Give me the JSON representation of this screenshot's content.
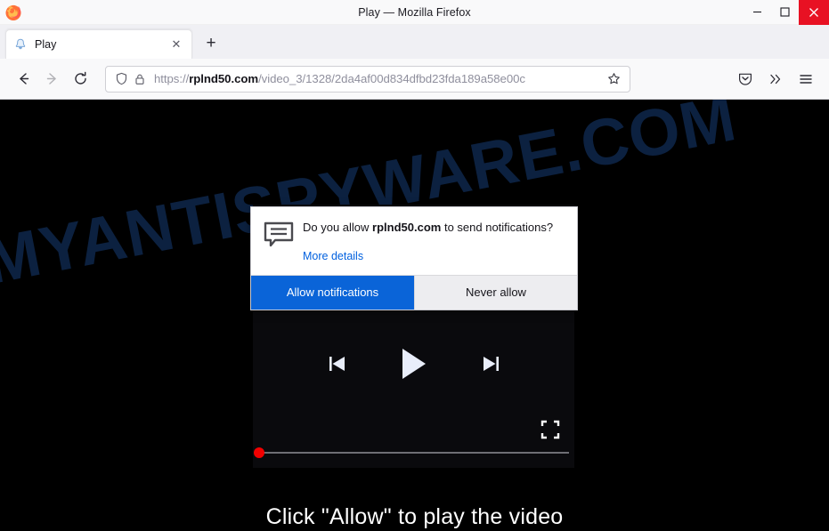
{
  "window": {
    "title": "Play — Mozilla Firefox",
    "controls": {
      "minimize": "—",
      "maximize": "☐",
      "close": "✕"
    }
  },
  "tabs": {
    "items": [
      {
        "label": "Play",
        "favicon": "bell-icon",
        "close_label": "✕"
      }
    ],
    "new_tab_label": "+"
  },
  "toolbar": {
    "back_label": "←",
    "forward_label": "→",
    "reload_label": "↻",
    "url": {
      "scheme": "https://",
      "host": "rplnd50.com",
      "path": "/video_3/1328/2da4af00d834dfbd23fda189a58e00c",
      "full": "https://rplnd50.com/video_3/1328/2da4af00d834dfbd23fda189a58e00c"
    },
    "bookmark_label": "☆",
    "pocket_label": "pocket-icon",
    "overflow_label": "»",
    "menu_label": "☰"
  },
  "page": {
    "watermark": "MYANTISPYWARE.COM",
    "caption": "Click \"Allow\" to play the video",
    "player": {
      "previous_label": "previous-track-icon",
      "play_label": "play-icon",
      "next_label": "next-track-icon",
      "fullscreen_label": "fullscreen-icon",
      "progress_percent": 0
    }
  },
  "permission_popup": {
    "icon": "notification-bubble-icon",
    "question_prefix": "Do you allow ",
    "question_host": "rplnd50.com",
    "question_suffix": " to send notifications?",
    "more_details_label": "More details",
    "allow_label": "Allow notifications",
    "never_label": "Never allow"
  },
  "colors": {
    "accent_blue": "#0a64d8",
    "link_blue": "#0060df",
    "close_red": "#e81123",
    "scrubber_red": "#f20000",
    "watermark_blue": "#0d2344"
  }
}
